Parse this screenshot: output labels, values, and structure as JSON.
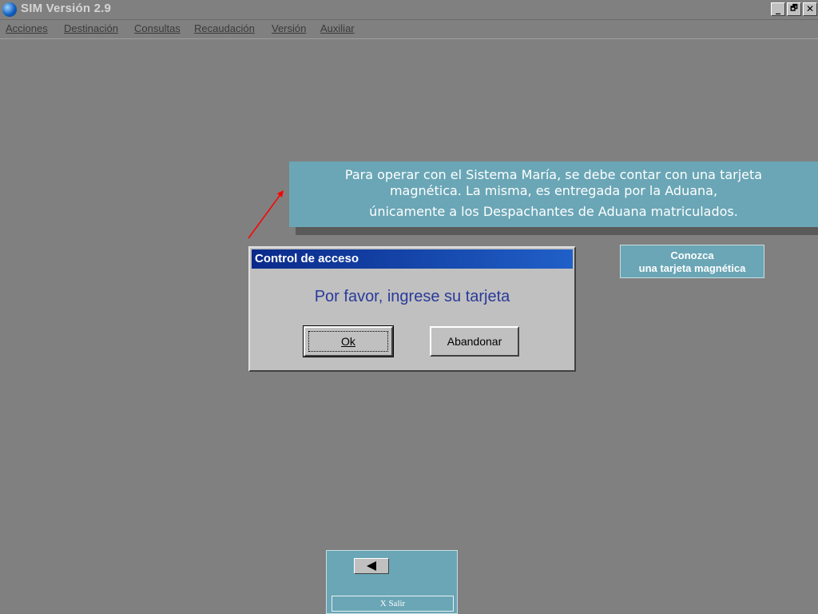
{
  "window": {
    "title": "SIM Versión 2.9",
    "controls": {
      "minimize": "_",
      "restore": "🗗",
      "close": "✕"
    }
  },
  "menu": {
    "items": [
      {
        "label": "Acciones"
      },
      {
        "label": "Destinación"
      },
      {
        "label": "Consultas"
      },
      {
        "label": "Recaudación"
      },
      {
        "label": "Versión"
      },
      {
        "label": "Auxiliar"
      }
    ]
  },
  "callout": {
    "line1": "Para operar con el Sistema María, se debe contar con una tarjeta",
    "line2": "magnética. La misma, es entregada por la Aduana,",
    "line3": "únicamente a los Despachantes  de Aduana matriculados."
  },
  "dialog": {
    "title": "Control de acceso",
    "message": "Por favor, ingrese su tarjeta",
    "ok_label": "Ok",
    "abort_label": "Abandonar"
  },
  "info_button": {
    "line1": "Conozca",
    "line2": "una tarjeta magnética"
  },
  "nav": {
    "exit_label": "X  Salir"
  },
  "colors": {
    "desktop": "#808080",
    "callout": "#6aa6b6",
    "dialog_title_start": "#0a2a8a",
    "dialog_title_end": "#2060c8",
    "arrow": "#ff0000"
  }
}
